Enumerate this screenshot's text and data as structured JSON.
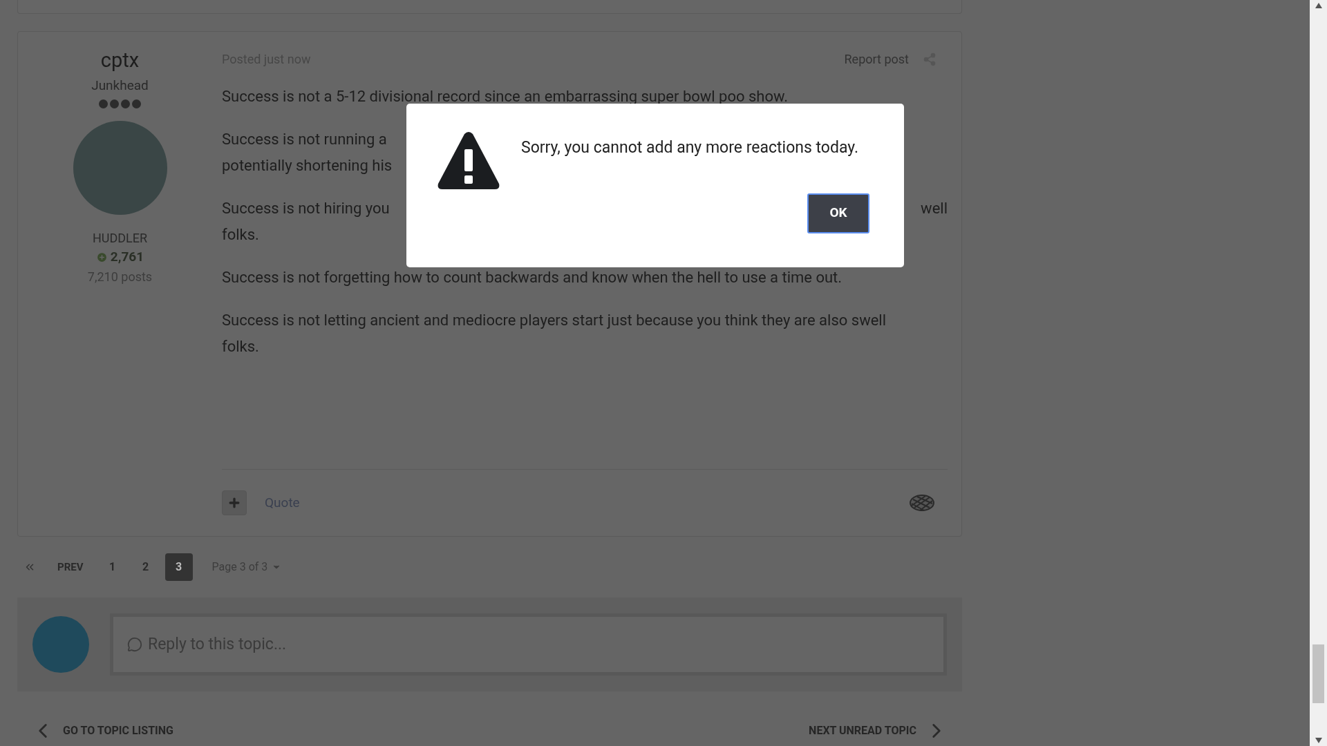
{
  "post": {
    "author": "cptx",
    "rank_title": "Junkhead",
    "group": "HUDDLER",
    "reputation": "2,761",
    "post_count": "7,210 posts",
    "posted": "Posted just now",
    "report": "Report post",
    "paragraphs": [
      {
        "kind": "text",
        "text": "Success is not a 5-12 divisional record since an embarrassing super bowl poo show."
      },
      {
        "kind": "lines",
        "lines": [
          {
            "left": "Success is not running a"
          },
          {
            "left": "potentially shortening his"
          }
        ]
      },
      {
        "kind": "lines",
        "lines": [
          {
            "left": "Success is not hiring you",
            "right": "well"
          },
          {
            "left": "folks."
          }
        ]
      },
      {
        "kind": "text",
        "text": "Success is not forgetting how to count backwards and know when the hell to use a time out."
      },
      {
        "kind": "text",
        "text": "Success is not letting ancient and mediocre players start just because you think they are also swell folks."
      }
    ],
    "quote": "Quote"
  },
  "pagination": {
    "prev": "PREV",
    "pages": [
      {
        "label": "1",
        "selected": false
      },
      {
        "label": "2",
        "selected": false
      },
      {
        "label": "3",
        "selected": true
      }
    ],
    "page_of": "Page 3 of 3"
  },
  "reply": {
    "placeholder": "Reply to this topic..."
  },
  "bottom_nav": {
    "back": "GO TO TOPIC LISTING",
    "next": "NEXT UNREAD TOPIC"
  },
  "dialog": {
    "message": "Sorry, you cannot add any more reactions today.",
    "button": "OK"
  }
}
